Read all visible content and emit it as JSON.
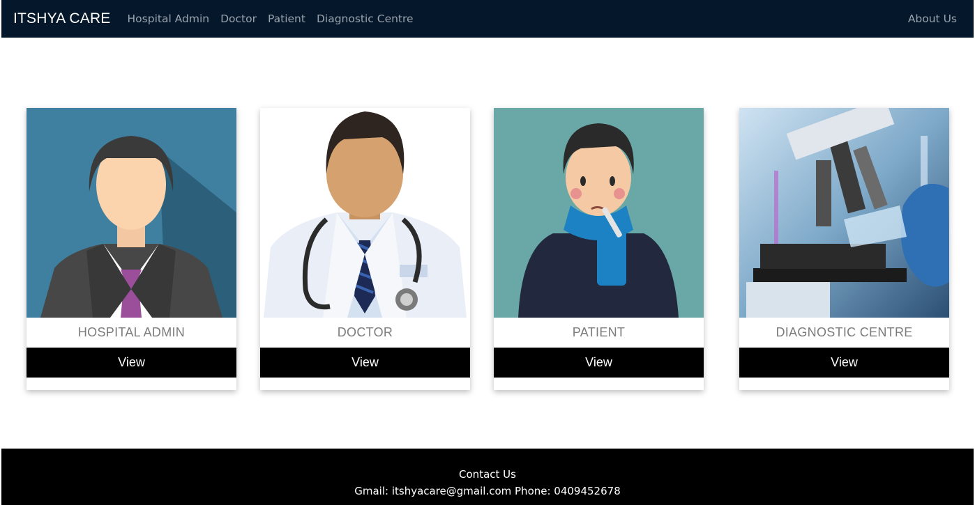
{
  "nav": {
    "brand": "ITSHYA CARE",
    "links": [
      "Hospital Admin",
      "Doctor",
      "Patient",
      "Diagnostic Centre"
    ],
    "right_link": "About Us"
  },
  "cards": [
    {
      "title": "HOSPITAL ADMIN",
      "button": "View",
      "icon": "admin-avatar-icon"
    },
    {
      "title": "DOCTOR",
      "button": "View",
      "icon": "doctor-avatar-icon"
    },
    {
      "title": "PATIENT",
      "button": "View",
      "icon": "patient-avatar-icon"
    },
    {
      "title": "DIAGNOSTIC CENTRE",
      "button": "View",
      "icon": "microscope-icon"
    }
  ],
  "footer": {
    "heading": "Contact Us",
    "contact": "Gmail: itshyacare@gmail.com Phone: 0409452678"
  },
  "colors": {
    "navbar_bg": "#05182b",
    "footer_bg": "#000000",
    "button_bg": "#000000",
    "admin_bg": "#3f7fa0",
    "patient_bg": "#6aa8a8"
  }
}
